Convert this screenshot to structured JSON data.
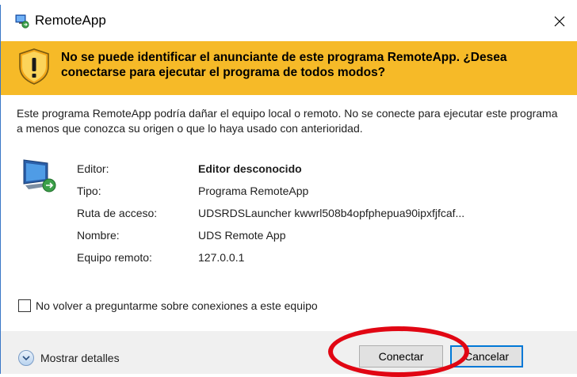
{
  "window": {
    "title": "RemoteApp",
    "close_glyph": "✕"
  },
  "warning": {
    "message": "No se puede identificar el anunciante de este programa RemoteApp. ¿Desea conectarse para ejecutar el programa de todos modos?",
    "icon": "shield-warning-icon",
    "band_color": "#f6ba28"
  },
  "description": "Este programa RemoteApp podría dañar el equipo local o remoto. No se conecte para ejecutar este programa a menos que conozca su origen o que lo haya usado con anterioridad.",
  "details": [
    {
      "label": "Editor:",
      "value": "Editor desconocido"
    },
    {
      "label": "Tipo:",
      "value": "Programa RemoteApp"
    },
    {
      "label": "Ruta de acceso:",
      "value": "UDSRDSLauncher kwwrl508b4opfphepua90ipxfjfcaf..."
    },
    {
      "label": "Nombre:",
      "value": "UDS Remote App"
    },
    {
      "label": "Equipo remoto:",
      "value": "127.0.0.1"
    }
  ],
  "checkbox": {
    "label": "No volver a preguntarme sobre conexiones a este equipo",
    "checked": false
  },
  "footer": {
    "more_details_label": "Mostrar detalles",
    "connect_label": "Conectar",
    "cancel_label": "Cancelar",
    "highlight_color": "#e10613"
  }
}
